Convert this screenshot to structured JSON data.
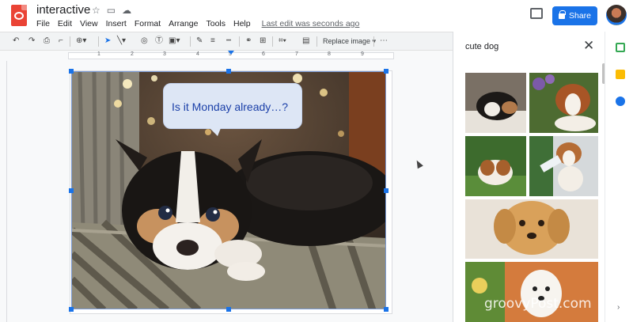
{
  "header": {
    "title": "interactive",
    "menus": [
      "File",
      "Edit",
      "View",
      "Insert",
      "Format",
      "Arrange",
      "Tools",
      "Help"
    ],
    "last_edit": "Last edit was seconds ago",
    "share_label": "Share"
  },
  "toolbar": {
    "replace_image_label": "Replace image"
  },
  "ruler": {
    "numbers": [
      "1",
      "2",
      "3",
      "4",
      "5",
      "6",
      "7",
      "8",
      "9"
    ]
  },
  "slide": {
    "bubble_text": "Is it Monday already…?"
  },
  "search_panel": {
    "query": "cute dog",
    "result_count_visible": 6
  },
  "watermark": "groovyPost.com",
  "colors": {
    "accent": "#1a73e8",
    "brand_red": "#ea4335"
  }
}
